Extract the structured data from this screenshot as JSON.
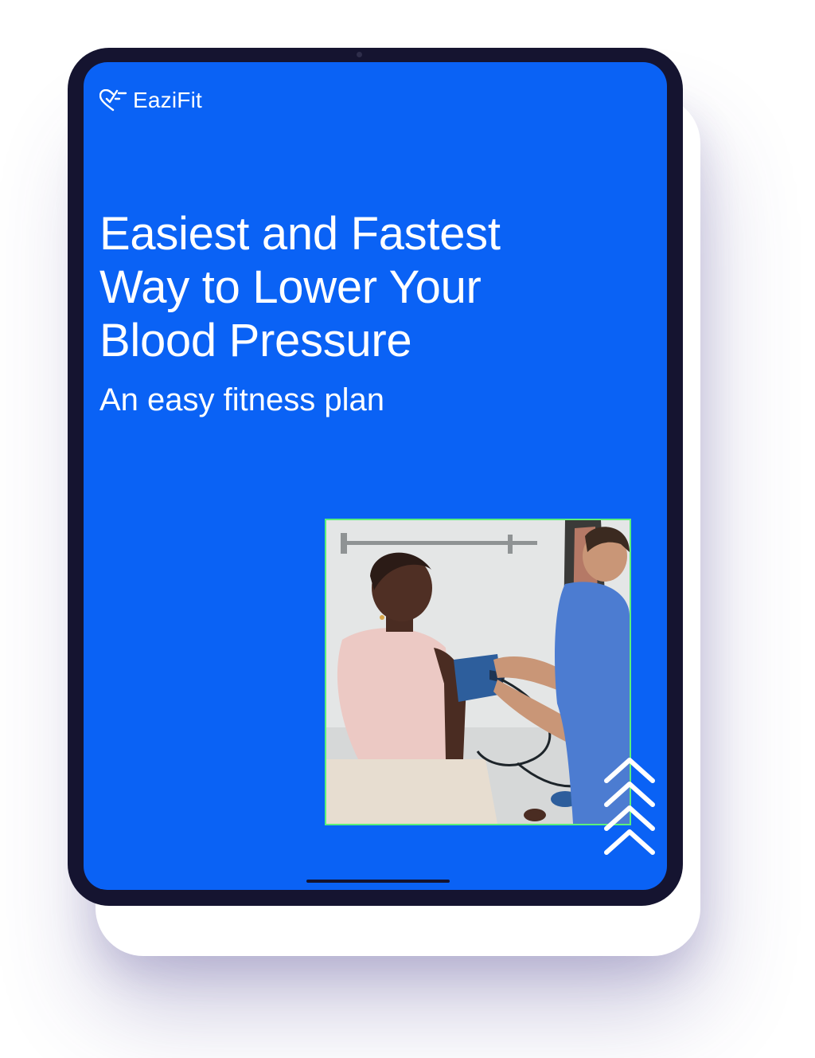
{
  "brand": {
    "name": "EaziFit",
    "logo_icon": "heart-pulse-logo-icon"
  },
  "cover": {
    "title_lines": [
      "Easiest and Fastest",
      "Way to Lower Your",
      "Blood Pressure"
    ],
    "subtitle": "An easy fitness plan",
    "photo_icon": "blood-pressure-check-photo",
    "decoration_icon": "chevrons-up-icon"
  },
  "colors": {
    "screen_background": "#0a62f5",
    "device_frame": "#151430",
    "photo_border": "#5cf07a",
    "text": "#ffffff"
  }
}
